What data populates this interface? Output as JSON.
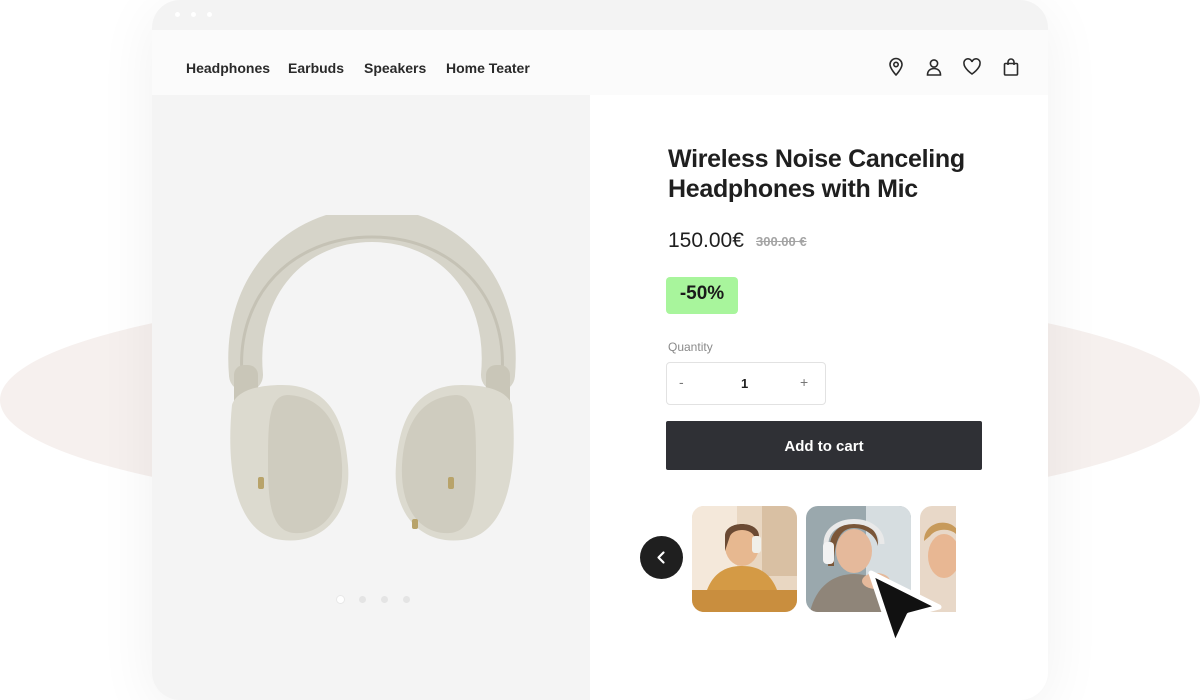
{
  "nav": {
    "links": [
      "Headphones",
      "Earbuds",
      "Speakers",
      "Home Teater"
    ],
    "icons": [
      "location-icon",
      "user-icon",
      "heart-icon",
      "bag-icon"
    ]
  },
  "product": {
    "title": "Wireless Noise Canceling Headphones with Mic",
    "price": "150.00€",
    "old_price": "300.00 €",
    "discount": "-50%",
    "quantity_label": "Quantity",
    "quantity_decrement": "-",
    "quantity_value": "1",
    "quantity_increment": "+",
    "add_to_cart_label": "Add to cart"
  },
  "gallery": {
    "dot_count": 4,
    "active_dot": 0
  },
  "colors": {
    "discount_bg": "#a8f59c",
    "cart_button": "#2f3035",
    "accent_dark": "#1f1f1f"
  }
}
